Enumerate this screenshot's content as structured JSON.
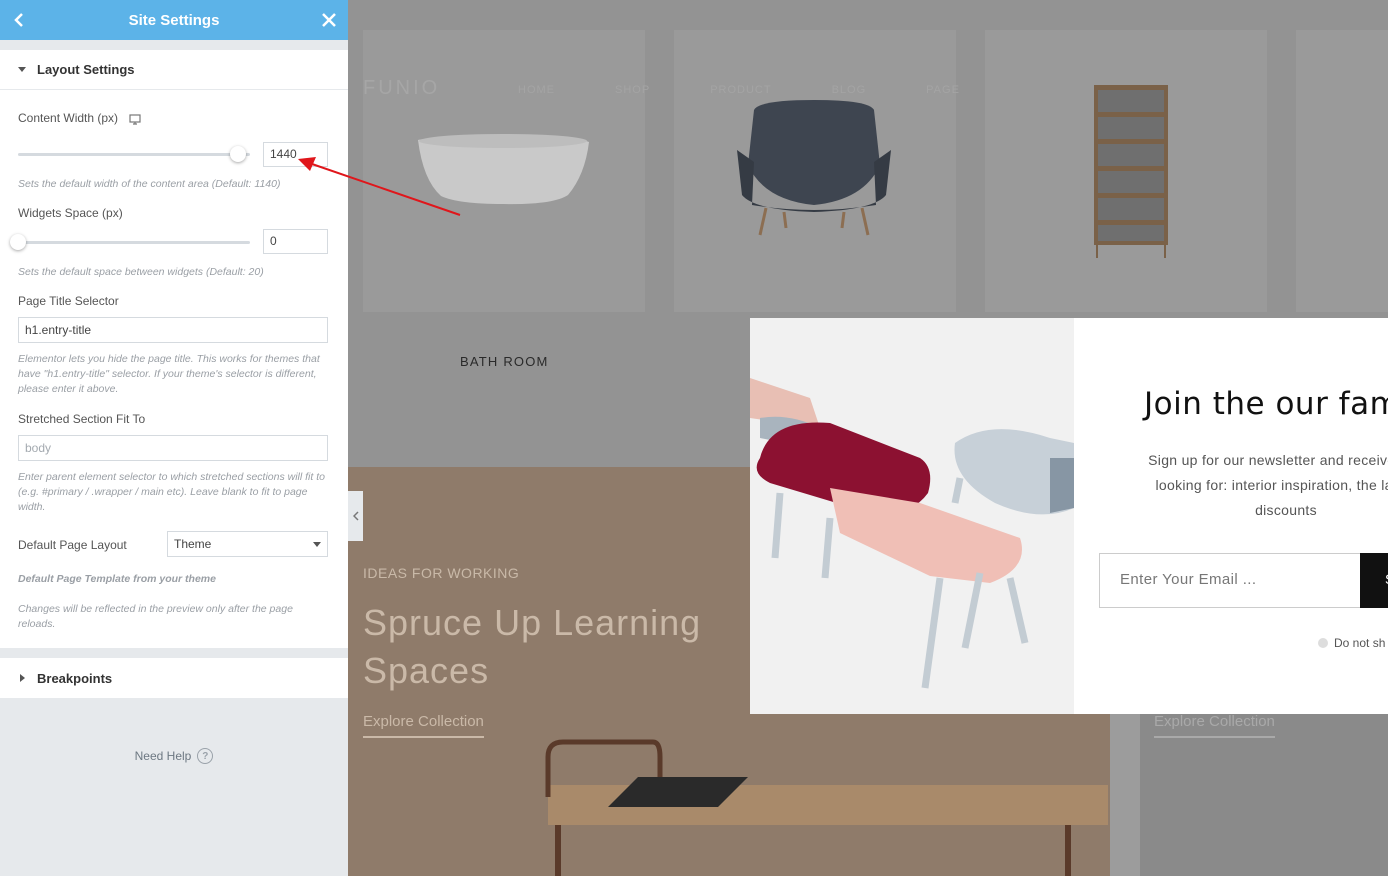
{
  "sidebar": {
    "header": {
      "title": "Site Settings",
      "back_icon": "chevron-left-icon",
      "close_icon": "close-icon"
    },
    "layout_section": {
      "title": "Layout Settings",
      "content_width": {
        "label": "Content Width (px)",
        "value": "1440",
        "slider_fraction": 0.95,
        "desc": "Sets the default width of the content area (Default: 1140)"
      },
      "widgets_space": {
        "label": "Widgets Space (px)",
        "value": "0",
        "slider_fraction": 0.0,
        "desc": "Sets the default space between widgets (Default: 20)"
      },
      "page_title_selector": {
        "label": "Page Title Selector",
        "value": "h1.entry-title",
        "desc": "Elementor lets you hide the page title. This works for themes that have \"h1.entry-title\" selector. If your theme's selector is different, please enter it above."
      },
      "stretched_section": {
        "label": "Stretched Section Fit To",
        "placeholder": "body",
        "desc": "Enter parent element selector to which stretched sections will fit to (e.g. #primary / .wrapper / main etc). Leave blank to fit to page width."
      },
      "default_page_layout": {
        "label": "Default Page Layout",
        "value": "Theme",
        "desc1": "Default Page Template from your theme",
        "desc2": "Changes will be reflected in the preview only after the page reloads."
      }
    },
    "breakpoints_section": {
      "title": "Breakpoints"
    },
    "need_help": "Need Help"
  },
  "preview": {
    "nav_logo": "FUNIO",
    "nav_items": [
      "HOME",
      "SHOP",
      "PRODUCT",
      "BLOG",
      "PAGE"
    ],
    "cards": [
      {
        "label": "BATH ROOM"
      }
    ],
    "hero": {
      "eyebrow": "IDEAS FOR WORKING",
      "heading_line1": "Spruce Up Learning",
      "heading_line2": "Spaces",
      "link": "Explore Collection",
      "link_right": "Explore Collection"
    },
    "popup": {
      "title": "Join the our fam",
      "text_line1": "Sign up for our newsletter and receive upd",
      "text_line2": "looking for: interior inspiration, the latest",
      "text_line3": "discounts",
      "email_placeholder": "Enter Your Email ...",
      "button_label": "S",
      "checkbox_label": "Do not sh"
    }
  },
  "colors": {
    "header_blue": "#5cb3e8",
    "annotation_red": "#e0161b"
  }
}
